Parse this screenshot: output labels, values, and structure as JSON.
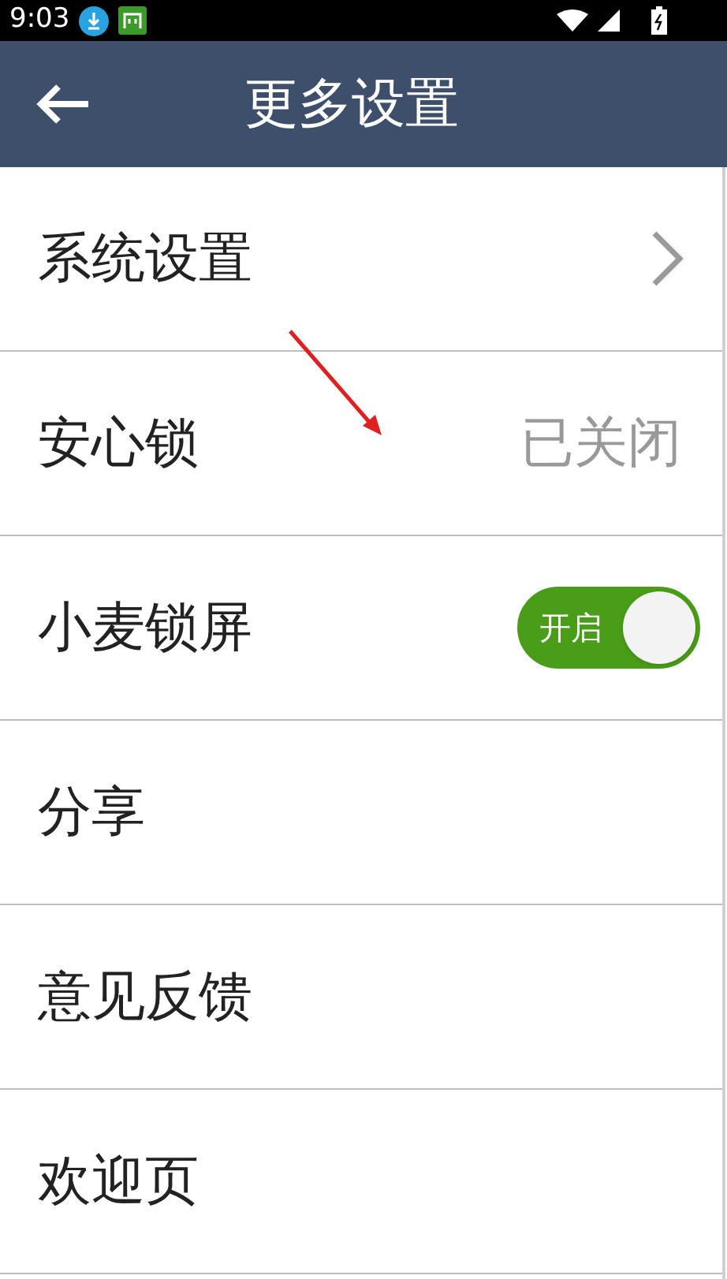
{
  "status_bar": {
    "time": "9:03"
  },
  "header": {
    "title": "更多设置"
  },
  "rows": [
    {
      "kind": "link",
      "label": "系统设置"
    },
    {
      "kind": "value",
      "label": "安心锁",
      "value": "已关闭"
    },
    {
      "kind": "toggle",
      "label": "小麦锁屏",
      "on": true,
      "toggle_label": "开启"
    },
    {
      "kind": "plain",
      "label": "分享"
    },
    {
      "kind": "plain",
      "label": "意见反馈"
    },
    {
      "kind": "plain",
      "label": "欢迎页"
    }
  ]
}
